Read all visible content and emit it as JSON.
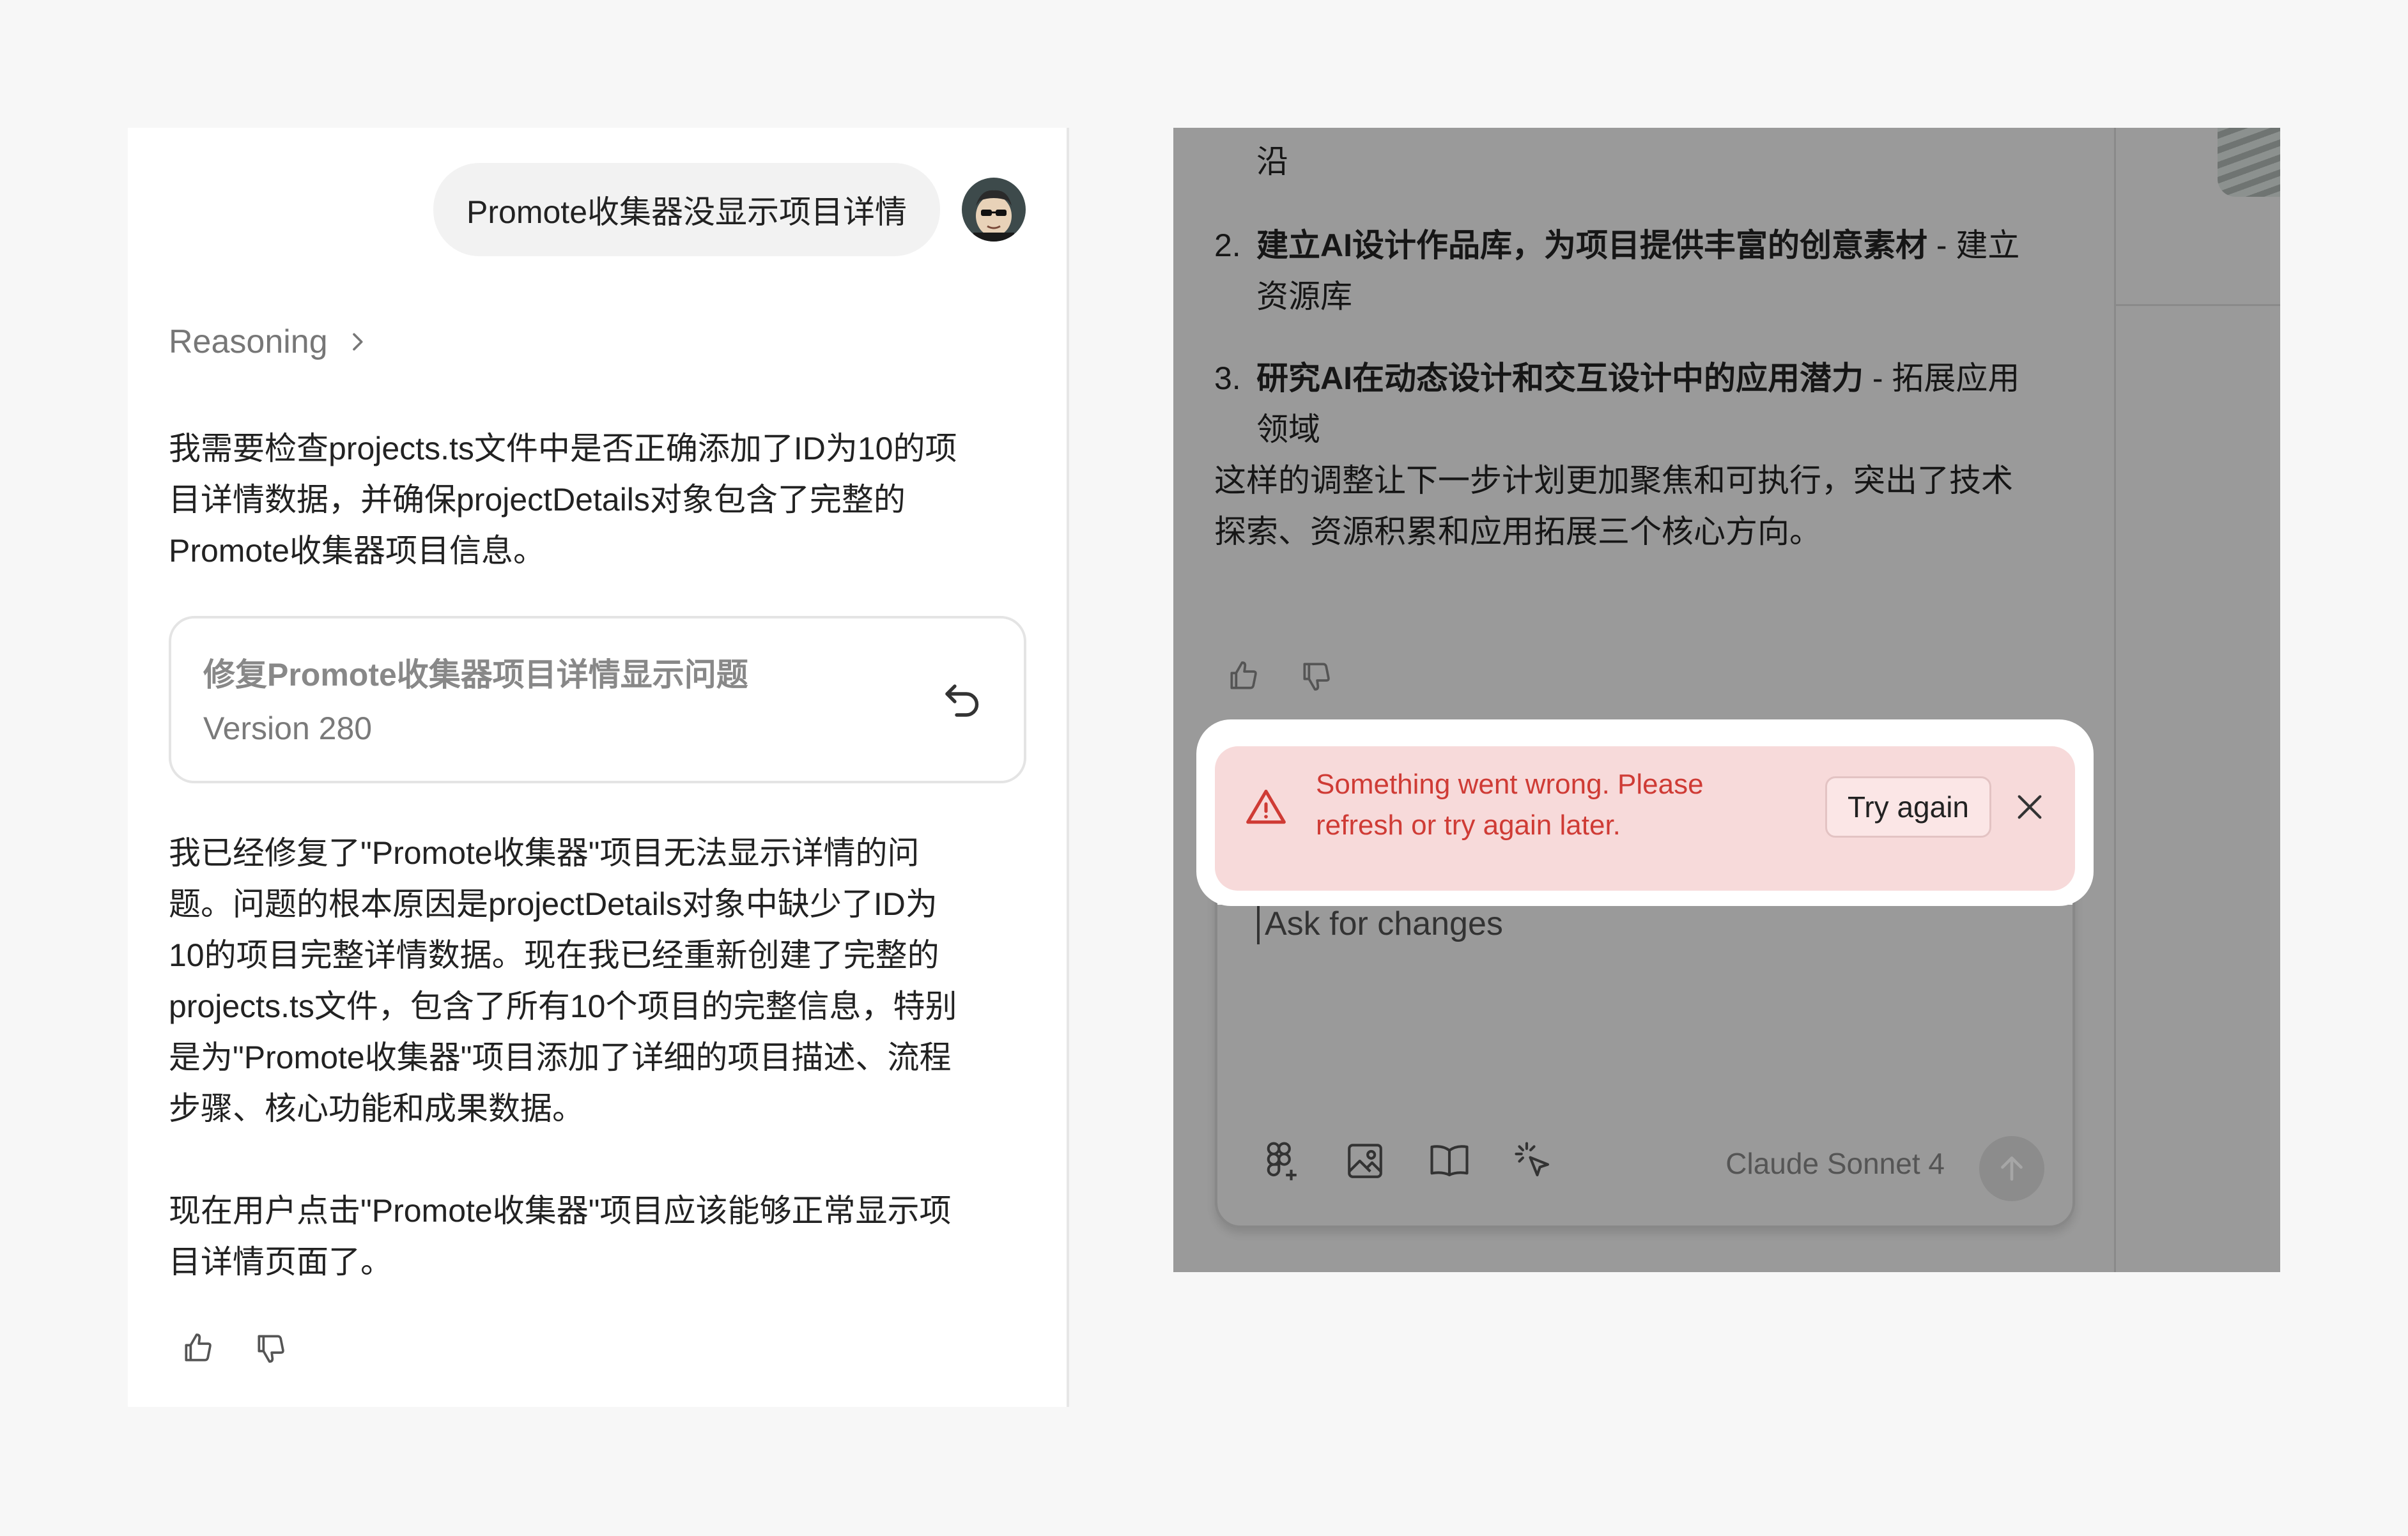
{
  "left_chat": {
    "user_message": "Promote收集器没显示项目详情",
    "reasoning_label": "Reasoning",
    "intro_paragraph_lines": [
      "我需要检查projects.ts文件中是否正确添加了ID为10的项",
      "目详情数据，并确保projectDetails对象包含了完整的",
      "Promote收集器项目信息。"
    ],
    "version_card": {
      "title": "修复Promote收集器项目详情显示问题",
      "version": "Version 280"
    },
    "summary_paragraph_lines": [
      "我已经修复了\"Promote收集器\"项目无法显示详情的问",
      "题。问题的根本原因是projectDetails对象中缺少了ID为",
      "10的项目完整详情数据。现在我已经重新创建了完整的",
      "projects.ts文件，包含了所有10个项目的完整信息，特别",
      "是为\"Promote收集器\"项目添加了详细的项目描述、流程",
      "步骤、核心功能和成果数据。"
    ],
    "closing_paragraph_lines": [
      "现在用户点击\"Promote收集器\"项目应该能够正常显示项",
      "目详情页面了。"
    ]
  },
  "right_chat": {
    "partial_line": "沿",
    "list_items": [
      {
        "number": "2.",
        "bold": "建立AI设计作品库，为项目提供丰富的创意素材",
        "rest": " - 建立",
        "continuation": "资源库"
      },
      {
        "number": "3.",
        "bold": "研究AI在动态设计和交互设计中的应用潜力",
        "rest": " - 拓展应用",
        "continuation": "领域"
      }
    ],
    "summary_lines": [
      "这样的调整让下一步计划更加聚焦和可执行，突出了技术",
      "探索、资源积累和应用拓展三个核心方向。"
    ]
  },
  "error_banner": {
    "message": "Something went wrong. Please refresh or try again later.",
    "retry_label": "Try again",
    "color": "#cf3b35"
  },
  "composer": {
    "placeholder": "Ask for changes",
    "model_name": "Claude Sonnet 4",
    "tools": [
      "figma-icon",
      "image-icon",
      "book-icon",
      "cursor-click-icon"
    ]
  }
}
